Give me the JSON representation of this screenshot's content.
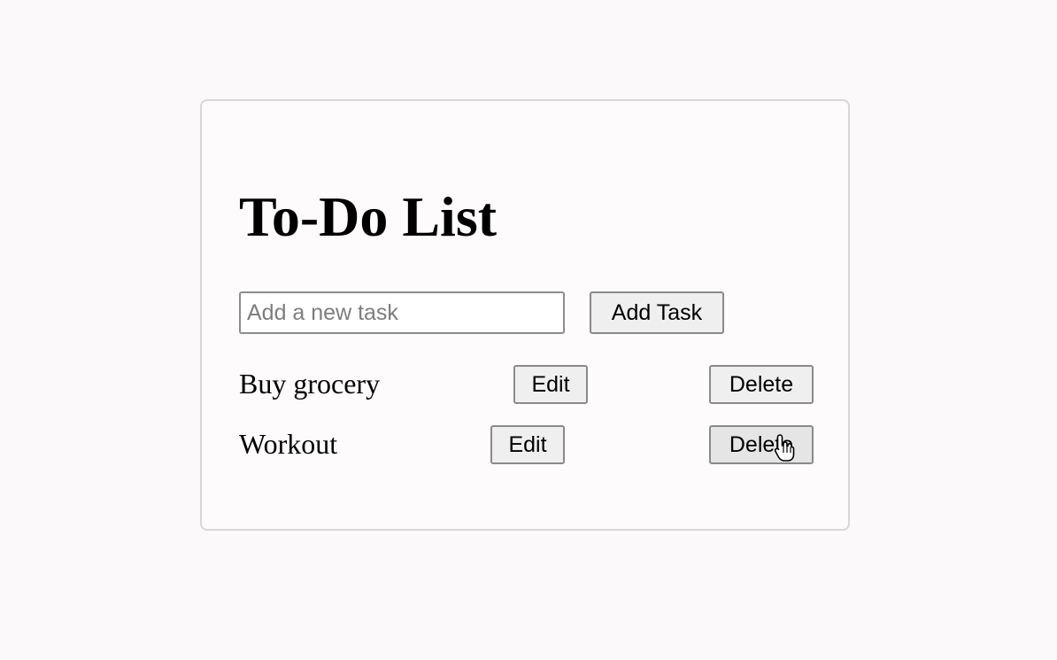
{
  "app": {
    "title": "To-Do List"
  },
  "new_task": {
    "value": "",
    "placeholder": "Add a new task",
    "add_label": "Add Task"
  },
  "tasks": [
    {
      "text": "Buy grocery",
      "edit_label": "Edit",
      "delete_label": "Delete"
    },
    {
      "text": "Workout",
      "edit_label": "Edit",
      "delete_label": "Delete"
    }
  ],
  "cursor": {
    "icon": "hand-pointer-icon"
  },
  "colors": {
    "page_background": "#fcf9fa",
    "card_border": "#d8d6d7",
    "button_background": "#efefef",
    "button_border": "#8a8a8a"
  }
}
